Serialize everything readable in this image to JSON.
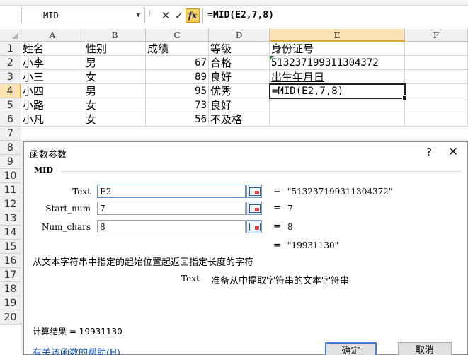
{
  "formula_bar": {
    "name_box": "MID",
    "cancel_glyph": "✕",
    "enter_glyph": "✓",
    "fx_label": "fx",
    "formula": "=MID(E2,7,8)"
  },
  "sheet": {
    "columns": [
      "A",
      "B",
      "C",
      "D",
      "E",
      "F"
    ],
    "selected_column": "E",
    "rows": [
      "1",
      "2",
      "3",
      "4",
      "5",
      "6",
      "7",
      "8",
      "9",
      "10",
      "11",
      "12",
      "13",
      "14",
      "15",
      "16",
      "17",
      "18",
      "19",
      "20"
    ],
    "selected_row": "4",
    "data": [
      {
        "a": "姓名",
        "b": "性别",
        "c": "成绩",
        "d": "等级",
        "e": "身份证号"
      },
      {
        "a": "小李",
        "b": "男",
        "c": "67",
        "d": "合格",
        "e": "513237199311304372"
      },
      {
        "a": "小三",
        "b": "女",
        "c": "89",
        "d": "良好",
        "e": "出生年月日"
      },
      {
        "a": "小四",
        "b": "男",
        "c": "95",
        "d": "优秀",
        "e": "=MID(E2,7,8)"
      },
      {
        "a": "小路",
        "b": "女",
        "c": "73",
        "d": "良好",
        "e": ""
      },
      {
        "a": "小凡",
        "b": "女",
        "c": "56",
        "d": "不及格",
        "e": ""
      }
    ]
  },
  "dialog": {
    "title": "函数参数",
    "help": "?",
    "close": "✕",
    "function_name": "MID",
    "args": [
      {
        "label": "Text",
        "value": "E2",
        "result": "\"513237199311304372\""
      },
      {
        "label": "Start_num",
        "value": "7",
        "result": "7"
      },
      {
        "label": "Num_chars",
        "value": "8",
        "result": "8"
      }
    ],
    "eq": "=",
    "formula_result": "\"19931130\"",
    "description": "从文本字符串中指定的起始位置起返回指定长度的字符",
    "arg_desc_name": "Text",
    "arg_desc": "准备从中提取字符串的文本字符串",
    "calc_result": "计算结果 = 19931130",
    "help_link": "有关该函数的帮助(H)",
    "ok": "确定",
    "cancel": "取消"
  }
}
